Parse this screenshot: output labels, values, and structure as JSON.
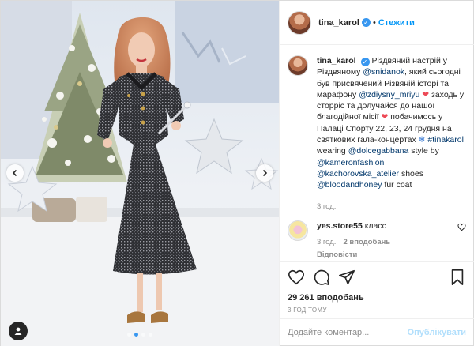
{
  "post": {
    "username": "tina_karol",
    "follow_label": "Стежити",
    "separator": "•",
    "verified_mark": "✓",
    "caption": {
      "t1": "Різдвяний настрій у Різдвяному ",
      "m1": "@snidanok",
      "t2": ", який сьогодні був присвячений Різвяній історі та марафону ",
      "m2": "@zdiysny_mriyu",
      "t3": " заходь у сторріс та долучайся до нашої благодійної місії ",
      "t4": " побачимось у Палаці Спорту 22, 23, 24 грудня на святкових гала-концертах ",
      "m3": "#tinakarol",
      "t5": " wearing ",
      "m4": "@dolcegabbana",
      "t6": " style by ",
      "m5": "@kameronfashion",
      "m6": "@kachorovska_atelier",
      "t7": " shoes ",
      "m7": "@bloodandhoney",
      "t8": " fur coat",
      "time": "3 год."
    },
    "comment": {
      "username": "yes.store55",
      "text": "класс",
      "time": "3 год.",
      "likes": "2 вподобань",
      "reply": "Відповісти"
    },
    "likes": "29 261 вподобань",
    "posted": "3 ГОД ТОМУ",
    "add_comment_placeholder": "Додайте коментар...",
    "publish_label": "Опублікувати",
    "carousel": {
      "slides": 4,
      "active": 1
    }
  },
  "icons": {
    "heart": "heart-icon",
    "comment": "comment-icon",
    "share": "share-icon",
    "save": "bookmark-icon",
    "snowflake": "snowflake-icon",
    "tag": "user-tag-icon"
  },
  "colors": {
    "link": "#00376b",
    "follow": "#0095f6",
    "publish_disabled": "#b2dffc",
    "heart_emoji": "#ed4956",
    "verified": "#3897f0"
  }
}
